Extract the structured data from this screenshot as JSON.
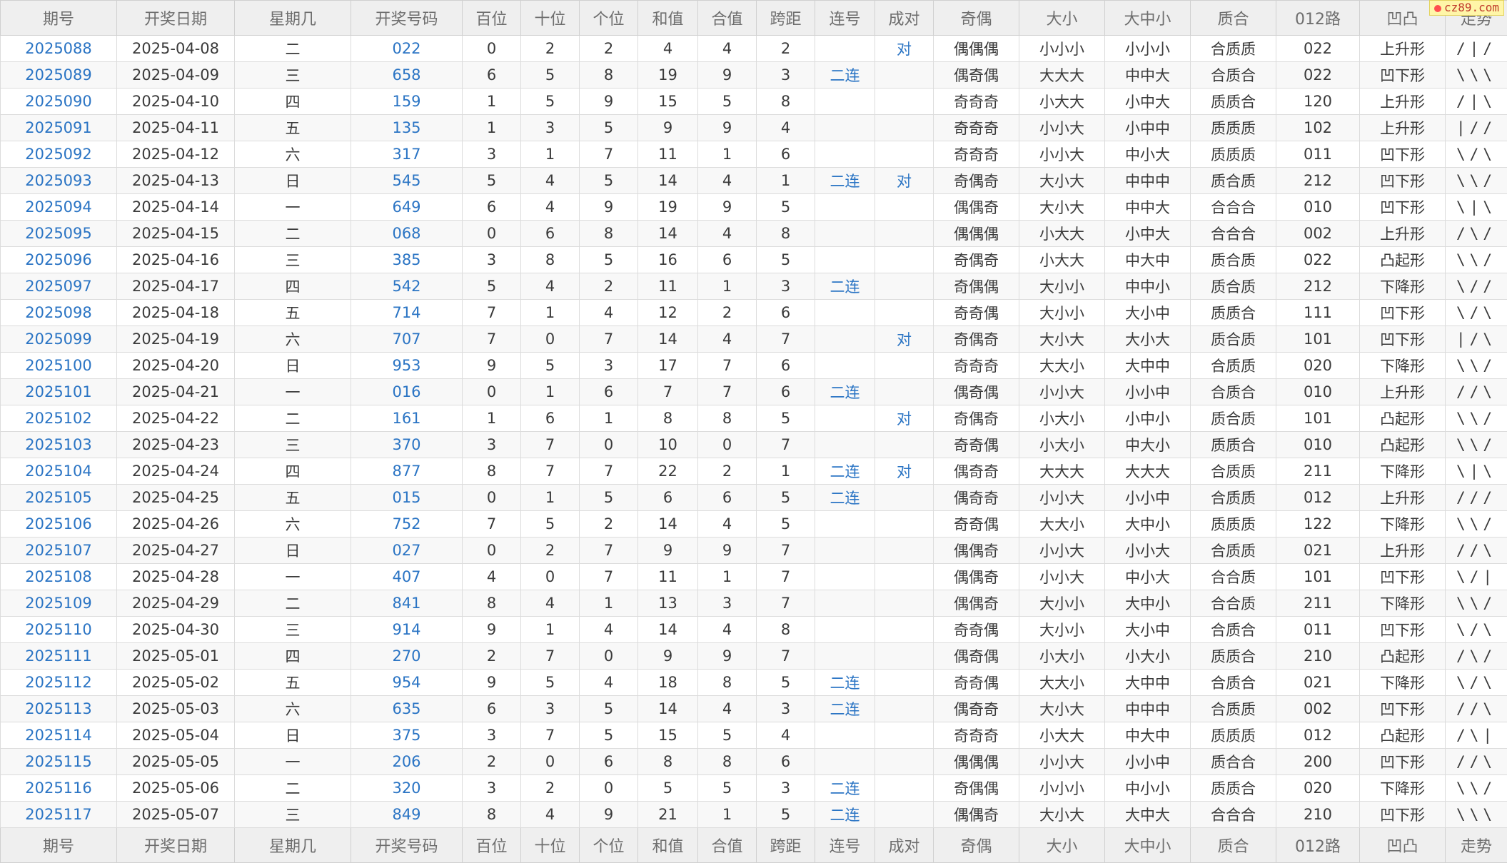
{
  "headers": [
    "期号",
    "开奖日期",
    "星期几",
    "开奖号码",
    "百位",
    "十位",
    "个位",
    "和值",
    "合值",
    "跨距",
    "连号",
    "成对",
    "奇偶",
    "大小",
    "大中小",
    "质合",
    "012路",
    "凹凸",
    "走势"
  ],
  "watermark": "cz89.com",
  "rows": [
    [
      "2025088",
      "2025-04-08",
      "二",
      "022",
      "0",
      "2",
      "2",
      "4",
      "4",
      "2",
      "",
      "对",
      "偶偶偶",
      "小小小",
      "小小小",
      "合质质",
      "022",
      "上升形",
      "/|/"
    ],
    [
      "2025089",
      "2025-04-09",
      "三",
      "658",
      "6",
      "5",
      "8",
      "19",
      "9",
      "3",
      "二连",
      "",
      "偶奇偶",
      "大大大",
      "中中大",
      "合质合",
      "022",
      "凹下形",
      "\\\\\\"
    ],
    [
      "2025090",
      "2025-04-10",
      "四",
      "159",
      "1",
      "5",
      "9",
      "15",
      "5",
      "8",
      "",
      "",
      "奇奇奇",
      "小大大",
      "小中大",
      "质质合",
      "120",
      "上升形",
      "/|\\"
    ],
    [
      "2025091",
      "2025-04-11",
      "五",
      "135",
      "1",
      "3",
      "5",
      "9",
      "9",
      "4",
      "",
      "",
      "奇奇奇",
      "小小大",
      "小中中",
      "质质质",
      "102",
      "上升形",
      "|//"
    ],
    [
      "2025092",
      "2025-04-12",
      "六",
      "317",
      "3",
      "1",
      "7",
      "11",
      "1",
      "6",
      "",
      "",
      "奇奇奇",
      "小小大",
      "中小大",
      "质质质",
      "011",
      "凹下形",
      "\\/\\"
    ],
    [
      "2025093",
      "2025-04-13",
      "日",
      "545",
      "5",
      "4",
      "5",
      "14",
      "4",
      "1",
      "二连",
      "对",
      "奇偶奇",
      "大小大",
      "中中中",
      "质合质",
      "212",
      "凹下形",
      "\\\\/"
    ],
    [
      "2025094",
      "2025-04-14",
      "一",
      "649",
      "6",
      "4",
      "9",
      "19",
      "9",
      "5",
      "",
      "",
      "偶偶奇",
      "大小大",
      "中中大",
      "合合合",
      "010",
      "凹下形",
      "\\|\\"
    ],
    [
      "2025095",
      "2025-04-15",
      "二",
      "068",
      "0",
      "6",
      "8",
      "14",
      "4",
      "8",
      "",
      "",
      "偶偶偶",
      "小大大",
      "小中大",
      "合合合",
      "002",
      "上升形",
      "/\\/"
    ],
    [
      "2025096",
      "2025-04-16",
      "三",
      "385",
      "3",
      "8",
      "5",
      "16",
      "6",
      "5",
      "",
      "",
      "奇偶奇",
      "小大大",
      "中大中",
      "质合质",
      "022",
      "凸起形",
      "\\\\/"
    ],
    [
      "2025097",
      "2025-04-17",
      "四",
      "542",
      "5",
      "4",
      "2",
      "11",
      "1",
      "3",
      "二连",
      "",
      "奇偶偶",
      "大小小",
      "中中小",
      "质合质",
      "212",
      "下降形",
      "\\//"
    ],
    [
      "2025098",
      "2025-04-18",
      "五",
      "714",
      "7",
      "1",
      "4",
      "12",
      "2",
      "6",
      "",
      "",
      "奇奇偶",
      "大小小",
      "大小中",
      "质质合",
      "111",
      "凹下形",
      "\\/\\"
    ],
    [
      "2025099",
      "2025-04-19",
      "六",
      "707",
      "7",
      "0",
      "7",
      "14",
      "4",
      "7",
      "",
      "对",
      "奇偶奇",
      "大小大",
      "大小大",
      "质合质",
      "101",
      "凹下形",
      "|/\\"
    ],
    [
      "2025100",
      "2025-04-20",
      "日",
      "953",
      "9",
      "5",
      "3",
      "17",
      "7",
      "6",
      "",
      "",
      "奇奇奇",
      "大大小",
      "大中中",
      "合质质",
      "020",
      "下降形",
      "\\\\/"
    ],
    [
      "2025101",
      "2025-04-21",
      "一",
      "016",
      "0",
      "1",
      "6",
      "7",
      "7",
      "6",
      "二连",
      "",
      "偶奇偶",
      "小小大",
      "小小中",
      "合质合",
      "010",
      "上升形",
      "//\\"
    ],
    [
      "2025102",
      "2025-04-22",
      "二",
      "161",
      "1",
      "6",
      "1",
      "8",
      "8",
      "5",
      "",
      "对",
      "奇偶奇",
      "小大小",
      "小中小",
      "质合质",
      "101",
      "凸起形",
      "\\\\/"
    ],
    [
      "2025103",
      "2025-04-23",
      "三",
      "370",
      "3",
      "7",
      "0",
      "10",
      "0",
      "7",
      "",
      "",
      "奇奇偶",
      "小大小",
      "中大小",
      "质质合",
      "010",
      "凸起形",
      "\\\\/"
    ],
    [
      "2025104",
      "2025-04-24",
      "四",
      "877",
      "8",
      "7",
      "7",
      "22",
      "2",
      "1",
      "二连",
      "对",
      "偶奇奇",
      "大大大",
      "大大大",
      "合质质",
      "211",
      "下降形",
      "\\|\\"
    ],
    [
      "2025105",
      "2025-04-25",
      "五",
      "015",
      "0",
      "1",
      "5",
      "6",
      "6",
      "5",
      "二连",
      "",
      "偶奇奇",
      "小小大",
      "小小中",
      "合质质",
      "012",
      "上升形",
      "///"
    ],
    [
      "2025106",
      "2025-04-26",
      "六",
      "752",
      "7",
      "5",
      "2",
      "14",
      "4",
      "5",
      "",
      "",
      "奇奇偶",
      "大大小",
      "大中小",
      "质质质",
      "122",
      "下降形",
      "\\\\/"
    ],
    [
      "2025107",
      "2025-04-27",
      "日",
      "027",
      "0",
      "2",
      "7",
      "9",
      "9",
      "7",
      "",
      "",
      "偶偶奇",
      "小小大",
      "小小大",
      "合质质",
      "021",
      "上升形",
      "//\\"
    ],
    [
      "2025108",
      "2025-04-28",
      "一",
      "407",
      "4",
      "0",
      "7",
      "11",
      "1",
      "7",
      "",
      "",
      "偶偶奇",
      "小小大",
      "中小大",
      "合合质",
      "101",
      "凹下形",
      "\\/|"
    ],
    [
      "2025109",
      "2025-04-29",
      "二",
      "841",
      "8",
      "4",
      "1",
      "13",
      "3",
      "7",
      "",
      "",
      "偶偶奇",
      "大小小",
      "大中小",
      "合合质",
      "211",
      "下降形",
      "\\\\/"
    ],
    [
      "2025110",
      "2025-04-30",
      "三",
      "914",
      "9",
      "1",
      "4",
      "14",
      "4",
      "8",
      "",
      "",
      "奇奇偶",
      "大小小",
      "大小中",
      "合质合",
      "011",
      "凹下形",
      "\\/\\"
    ],
    [
      "2025111",
      "2025-05-01",
      "四",
      "270",
      "2",
      "7",
      "0",
      "9",
      "9",
      "7",
      "",
      "",
      "偶奇偶",
      "小大小",
      "小大小",
      "质质合",
      "210",
      "凸起形",
      "/\\/"
    ],
    [
      "2025112",
      "2025-05-02",
      "五",
      "954",
      "9",
      "5",
      "4",
      "18",
      "8",
      "5",
      "二连",
      "",
      "奇奇偶",
      "大大小",
      "大中中",
      "合质合",
      "021",
      "下降形",
      "\\/\\"
    ],
    [
      "2025113",
      "2025-05-03",
      "六",
      "635",
      "6",
      "3",
      "5",
      "14",
      "4",
      "3",
      "二连",
      "",
      "偶奇奇",
      "大小大",
      "中中中",
      "合质质",
      "002",
      "凹下形",
      "//\\"
    ],
    [
      "2025114",
      "2025-05-04",
      "日",
      "375",
      "3",
      "7",
      "5",
      "15",
      "5",
      "4",
      "",
      "",
      "奇奇奇",
      "小大大",
      "中大中",
      "质质质",
      "012",
      "凸起形",
      "/\\|"
    ],
    [
      "2025115",
      "2025-05-05",
      "一",
      "206",
      "2",
      "0",
      "6",
      "8",
      "8",
      "6",
      "",
      "",
      "偶偶偶",
      "小小大",
      "小小中",
      "质合合",
      "200",
      "凹下形",
      "//\\"
    ],
    [
      "2025116",
      "2025-05-06",
      "二",
      "320",
      "3",
      "2",
      "0",
      "5",
      "5",
      "3",
      "二连",
      "",
      "奇偶偶",
      "小小小",
      "中小小",
      "质质合",
      "020",
      "下降形",
      "\\\\/"
    ],
    [
      "2025117",
      "2025-05-07",
      "三",
      "849",
      "8",
      "4",
      "9",
      "21",
      "1",
      "5",
      "二连",
      "",
      "偶偶奇",
      "大小大",
      "大中大",
      "合合合",
      "210",
      "凹下形",
      "\\\\\\"
    ]
  ]
}
